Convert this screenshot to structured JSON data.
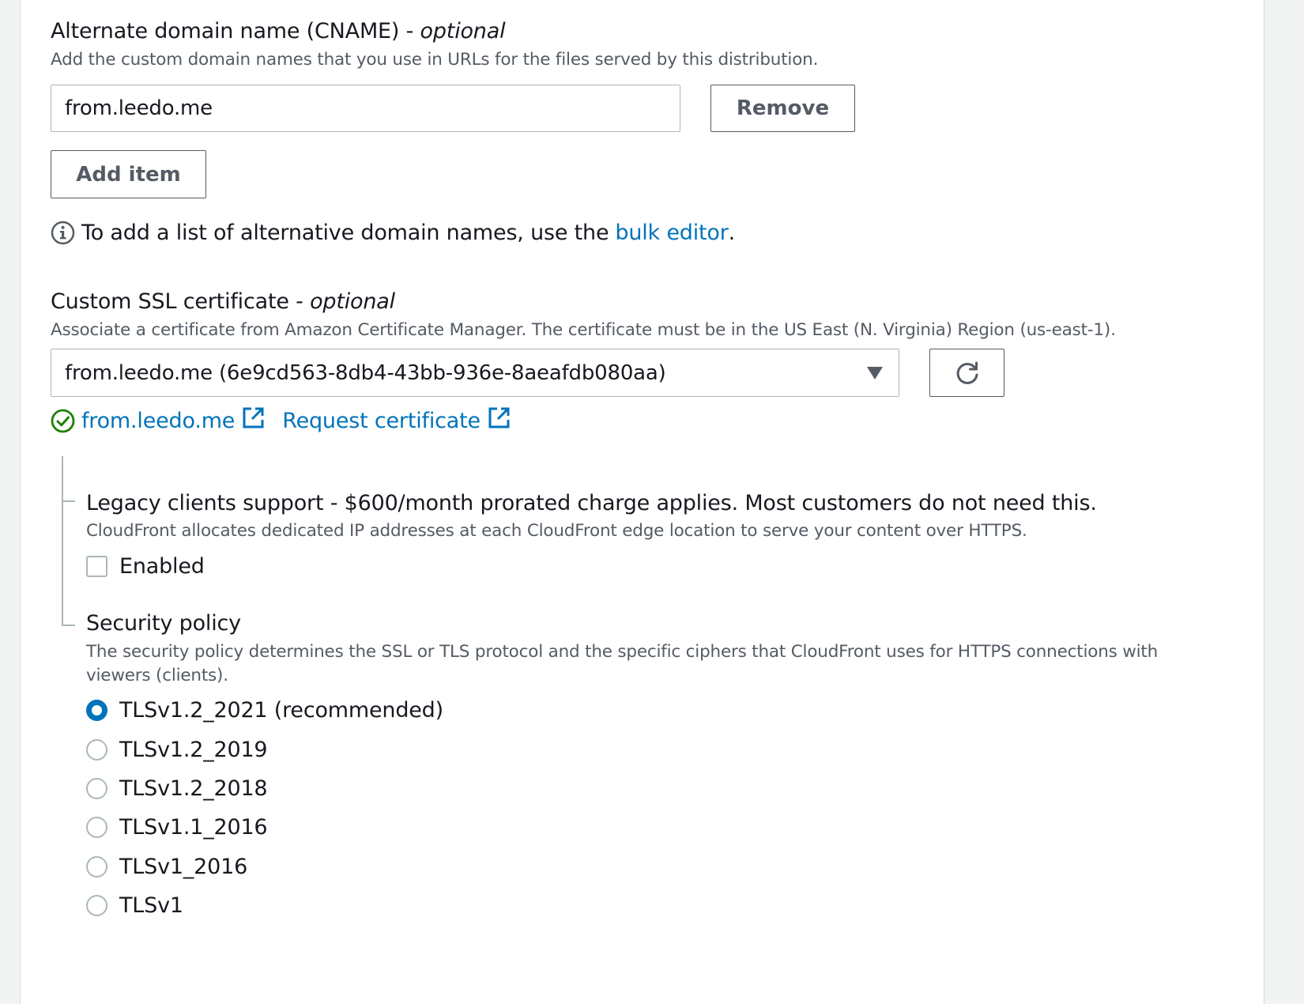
{
  "cname": {
    "label": "Alternate domain name (CNAME) - ",
    "label_optional": "optional",
    "description": "Add the custom domain names that you use in URLs for the files served by this distribution.",
    "items": [
      {
        "value": "from.leedo.me",
        "remove_label": "Remove"
      }
    ],
    "add_item_label": "Add item",
    "info_prefix": "To add a list of alternative domain names, use the ",
    "info_link": "bulk editor",
    "info_suffix": "."
  },
  "ssl": {
    "label": "Custom SSL certificate - ",
    "label_optional": "optional",
    "description": "Associate a certificate from Amazon Certificate Manager. The certificate must be in the US East (N. Virginia) Region (us-east-1).",
    "selected": "from.leedo.me (6e9cd563-8db4-43bb-936e-8aeafdb080aa)",
    "cert_link": "from.leedo.me",
    "request_link": "Request certificate"
  },
  "legacy": {
    "label": "Legacy clients support - $600/month prorated charge applies. Most customers do not need this.",
    "description": "CloudFront allocates dedicated IP addresses at each CloudFront edge location to serve your content over HTTPS.",
    "checkbox_label": "Enabled",
    "checked": false
  },
  "security_policy": {
    "label": "Security policy",
    "description_line1": "The security policy determines the SSL or TLS protocol and the specific ciphers that CloudFront uses for HTTPS connections with",
    "description_line2": "viewers (clients).",
    "options": [
      {
        "label": "TLSv1.2_2021 (recommended)",
        "checked": true
      },
      {
        "label": "TLSv1.2_2019",
        "checked": false
      },
      {
        "label": "TLSv1.2_2018",
        "checked": false
      },
      {
        "label": "TLSv1.1_2016",
        "checked": false
      },
      {
        "label": "TLSv1_2016",
        "checked": false
      },
      {
        "label": "TLSv1",
        "checked": false
      }
    ]
  },
  "colors": {
    "link": "#0073bb",
    "success": "#1d8102",
    "text": "#16191f",
    "secondary_text": "#545b64",
    "border": "#aab7b8"
  }
}
